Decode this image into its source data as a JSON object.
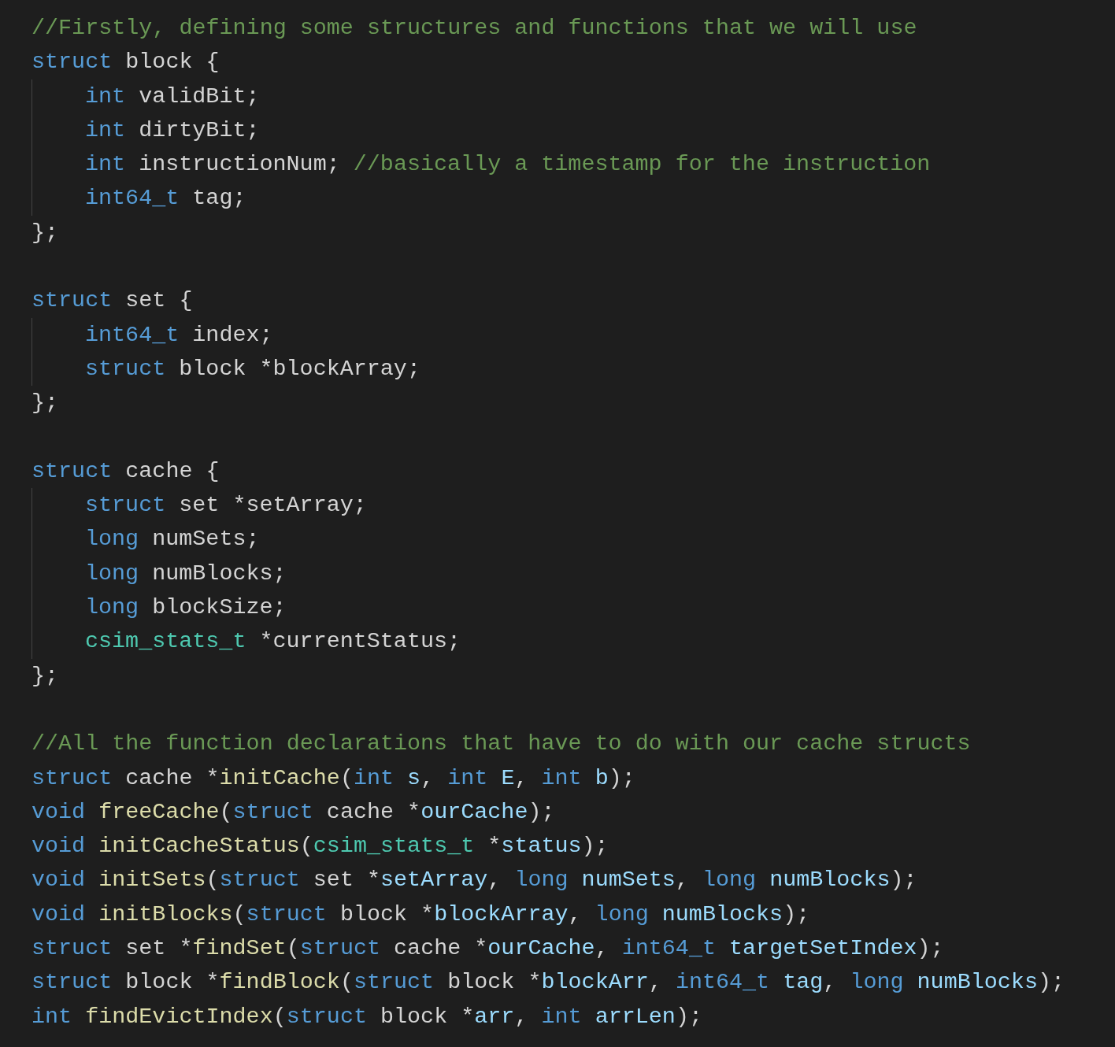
{
  "editor": {
    "blocks": [
      {
        "lines": [
          {
            "tokens": [
              {
                "kind": "comment",
                "text": "//Firstly, defining some structures and functions that we will use"
              }
            ]
          },
          {
            "tokens": [
              {
                "kind": "keyword",
                "text": "struct"
              },
              {
                "kind": "plain",
                "text": " block {"
              }
            ],
            "children": [
              {
                "tokens": [
                  {
                    "kind": "keyword",
                    "text": "int"
                  },
                  {
                    "kind": "plain",
                    "text": " validBit;"
                  }
                ]
              },
              {
                "tokens": [
                  {
                    "kind": "keyword",
                    "text": "int"
                  },
                  {
                    "kind": "plain",
                    "text": " dirtyBit;"
                  }
                ]
              },
              {
                "tokens": [
                  {
                    "kind": "keyword",
                    "text": "int"
                  },
                  {
                    "kind": "plain",
                    "text": " instructionNum; "
                  },
                  {
                    "kind": "comment",
                    "text": "//basically a timestamp for the instruction"
                  }
                ]
              },
              {
                "tokens": [
                  {
                    "kind": "keyword",
                    "text": "int64_t"
                  },
                  {
                    "kind": "plain",
                    "text": " tag;"
                  }
                ]
              }
            ]
          },
          {
            "tokens": [
              {
                "kind": "plain",
                "text": "};"
              }
            ]
          }
        ]
      },
      {
        "lines": [
          {
            "tokens": [
              {
                "kind": "keyword",
                "text": "struct"
              },
              {
                "kind": "plain",
                "text": " set {"
              }
            ],
            "children": [
              {
                "tokens": [
                  {
                    "kind": "keyword",
                    "text": "int64_t"
                  },
                  {
                    "kind": "plain",
                    "text": " index;"
                  }
                ]
              },
              {
                "tokens": [
                  {
                    "kind": "keyword",
                    "text": "struct"
                  },
                  {
                    "kind": "plain",
                    "text": " block *blockArray;"
                  }
                ]
              }
            ]
          },
          {
            "tokens": [
              {
                "kind": "plain",
                "text": "};"
              }
            ]
          }
        ]
      },
      {
        "lines": [
          {
            "tokens": [
              {
                "kind": "keyword",
                "text": "struct"
              },
              {
                "kind": "plain",
                "text": " cache {"
              }
            ],
            "children": [
              {
                "tokens": [
                  {
                    "kind": "keyword",
                    "text": "struct"
                  },
                  {
                    "kind": "plain",
                    "text": " set *setArray;"
                  }
                ]
              },
              {
                "tokens": [
                  {
                    "kind": "keyword",
                    "text": "long"
                  },
                  {
                    "kind": "plain",
                    "text": " numSets;"
                  }
                ]
              },
              {
                "tokens": [
                  {
                    "kind": "keyword",
                    "text": "long"
                  },
                  {
                    "kind": "plain",
                    "text": " numBlocks;"
                  }
                ]
              },
              {
                "tokens": [
                  {
                    "kind": "keyword",
                    "text": "long"
                  },
                  {
                    "kind": "plain",
                    "text": " blockSize;"
                  }
                ]
              },
              {
                "tokens": [
                  {
                    "kind": "type",
                    "text": "csim_stats_t"
                  },
                  {
                    "kind": "plain",
                    "text": " *currentStatus;"
                  }
                ]
              }
            ]
          },
          {
            "tokens": [
              {
                "kind": "plain",
                "text": "};"
              }
            ]
          }
        ]
      },
      {
        "lines": [
          {
            "tokens": [
              {
                "kind": "comment",
                "text": "//All the function declarations that have to do with our cache structs"
              }
            ]
          },
          {
            "tokens": [
              {
                "kind": "keyword",
                "text": "struct"
              },
              {
                "kind": "plain",
                "text": " cache *"
              },
              {
                "kind": "function",
                "text": "initCache"
              },
              {
                "kind": "plain",
                "text": "("
              },
              {
                "kind": "keyword",
                "text": "int "
              },
              {
                "kind": "param",
                "text": "s"
              },
              {
                "kind": "plain",
                "text": ", "
              },
              {
                "kind": "keyword",
                "text": "int "
              },
              {
                "kind": "param",
                "text": "E"
              },
              {
                "kind": "plain",
                "text": ", "
              },
              {
                "kind": "keyword",
                "text": "int "
              },
              {
                "kind": "param",
                "text": "b"
              },
              {
                "kind": "plain",
                "text": ");"
              }
            ]
          },
          {
            "tokens": [
              {
                "kind": "keyword",
                "text": "void "
              },
              {
                "kind": "function",
                "text": "freeCache"
              },
              {
                "kind": "plain",
                "text": "("
              },
              {
                "kind": "keyword",
                "text": "struct"
              },
              {
                "kind": "plain",
                "text": " cache *"
              },
              {
                "kind": "param",
                "text": "ourCache"
              },
              {
                "kind": "plain",
                "text": ");"
              }
            ]
          },
          {
            "tokens": [
              {
                "kind": "keyword",
                "text": "void "
              },
              {
                "kind": "function",
                "text": "initCacheStatus"
              },
              {
                "kind": "plain",
                "text": "("
              },
              {
                "kind": "type",
                "text": "csim_stats_t"
              },
              {
                "kind": "plain",
                "text": " *"
              },
              {
                "kind": "param",
                "text": "status"
              },
              {
                "kind": "plain",
                "text": ");"
              }
            ]
          },
          {
            "tokens": [
              {
                "kind": "keyword",
                "text": "void "
              },
              {
                "kind": "function",
                "text": "initSets"
              },
              {
                "kind": "plain",
                "text": "("
              },
              {
                "kind": "keyword",
                "text": "struct"
              },
              {
                "kind": "plain",
                "text": " set *"
              },
              {
                "kind": "param",
                "text": "setArray"
              },
              {
                "kind": "plain",
                "text": ", "
              },
              {
                "kind": "keyword",
                "text": "long "
              },
              {
                "kind": "param",
                "text": "numSets"
              },
              {
                "kind": "plain",
                "text": ", "
              },
              {
                "kind": "keyword",
                "text": "long "
              },
              {
                "kind": "param",
                "text": "numBlocks"
              },
              {
                "kind": "plain",
                "text": ");"
              }
            ]
          },
          {
            "tokens": [
              {
                "kind": "keyword",
                "text": "void "
              },
              {
                "kind": "function",
                "text": "initBlocks"
              },
              {
                "kind": "plain",
                "text": "("
              },
              {
                "kind": "keyword",
                "text": "struct"
              },
              {
                "kind": "plain",
                "text": " block *"
              },
              {
                "kind": "param",
                "text": "blockArray"
              },
              {
                "kind": "plain",
                "text": ", "
              },
              {
                "kind": "keyword",
                "text": "long "
              },
              {
                "kind": "param",
                "text": "numBlocks"
              },
              {
                "kind": "plain",
                "text": ");"
              }
            ]
          },
          {
            "tokens": [
              {
                "kind": "keyword",
                "text": "struct"
              },
              {
                "kind": "plain",
                "text": " set *"
              },
              {
                "kind": "function",
                "text": "findSet"
              },
              {
                "kind": "plain",
                "text": "("
              },
              {
                "kind": "keyword",
                "text": "struct"
              },
              {
                "kind": "plain",
                "text": " cache *"
              },
              {
                "kind": "param",
                "text": "ourCache"
              },
              {
                "kind": "plain",
                "text": ", "
              },
              {
                "kind": "keyword",
                "text": "int64_t "
              },
              {
                "kind": "param",
                "text": "targetSetIndex"
              },
              {
                "kind": "plain",
                "text": ");"
              }
            ]
          },
          {
            "tokens": [
              {
                "kind": "keyword",
                "text": "struct"
              },
              {
                "kind": "plain",
                "text": " block *"
              },
              {
                "kind": "function",
                "text": "findBlock"
              },
              {
                "kind": "plain",
                "text": "("
              },
              {
                "kind": "keyword",
                "text": "struct"
              },
              {
                "kind": "plain",
                "text": " block *"
              },
              {
                "kind": "param",
                "text": "blockArr"
              },
              {
                "kind": "plain",
                "text": ", "
              },
              {
                "kind": "keyword",
                "text": "int64_t "
              },
              {
                "kind": "param",
                "text": "tag"
              },
              {
                "kind": "plain",
                "text": ", "
              },
              {
                "kind": "keyword",
                "text": "long "
              },
              {
                "kind": "param",
                "text": "numBlocks"
              },
              {
                "kind": "plain",
                "text": ");"
              }
            ]
          },
          {
            "tokens": [
              {
                "kind": "keyword",
                "text": "int "
              },
              {
                "kind": "function",
                "text": "findEvictIndex"
              },
              {
                "kind": "plain",
                "text": "("
              },
              {
                "kind": "keyword",
                "text": "struct"
              },
              {
                "kind": "plain",
                "text": " block *"
              },
              {
                "kind": "param",
                "text": "arr"
              },
              {
                "kind": "plain",
                "text": ", "
              },
              {
                "kind": "keyword",
                "text": "int "
              },
              {
                "kind": "param",
                "text": "arrLen"
              },
              {
                "kind": "plain",
                "text": ");"
              }
            ]
          }
        ]
      }
    ]
  }
}
